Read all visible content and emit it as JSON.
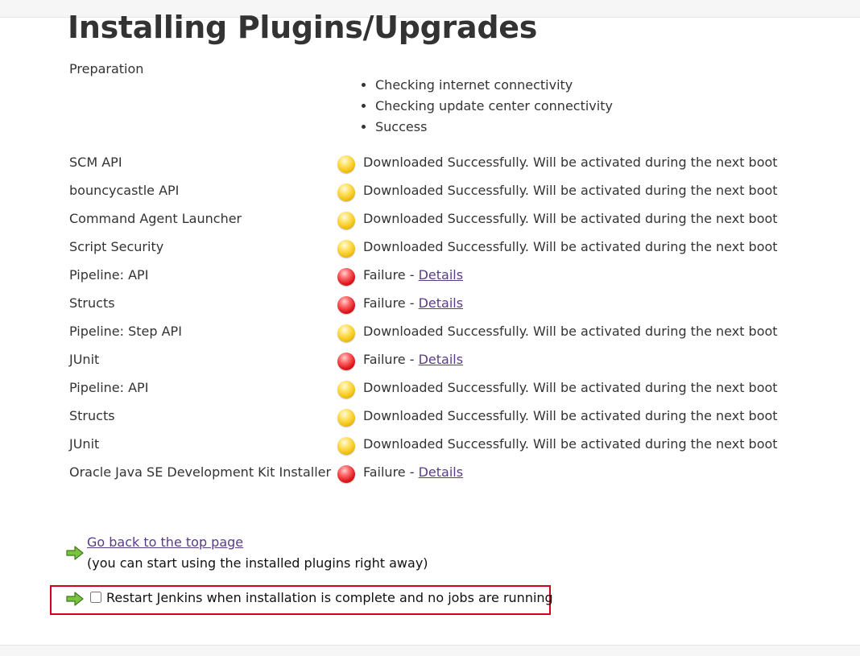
{
  "page": {
    "title": "Installing Plugins/Upgrades"
  },
  "preparation": {
    "label": "Preparation",
    "steps": [
      "Checking internet connectivity",
      "Checking update center connectivity",
      "Success"
    ]
  },
  "plugins": [
    {
      "name": "SCM API",
      "status": "success",
      "message": "Downloaded Successfully. Will be activated during the next boot"
    },
    {
      "name": "bouncycastle API",
      "status": "success",
      "message": "Downloaded Successfully. Will be activated during the next boot"
    },
    {
      "name": "Command Agent Launcher",
      "status": "success",
      "message": "Downloaded Successfully. Will be activated during the next boot"
    },
    {
      "name": "Script Security",
      "status": "success",
      "message": "Downloaded Successfully. Will be activated during the next boot"
    },
    {
      "name": "Pipeline: API",
      "status": "failure",
      "message": "Failure - ",
      "link": "Details"
    },
    {
      "name": "Structs",
      "status": "failure",
      "message": "Failure - ",
      "link": "Details"
    },
    {
      "name": "Pipeline: Step API",
      "status": "success",
      "message": "Downloaded Successfully. Will be activated during the next boot"
    },
    {
      "name": "JUnit",
      "status": "failure",
      "message": "Failure - ",
      "link": "Details"
    },
    {
      "name": "Pipeline: API",
      "status": "success",
      "message": "Downloaded Successfully. Will be activated during the next boot"
    },
    {
      "name": "Structs",
      "status": "success",
      "message": "Downloaded Successfully. Will be activated during the next boot"
    },
    {
      "name": "JUnit",
      "status": "success",
      "message": "Downloaded Successfully. Will be activated during the next boot"
    },
    {
      "name": "Oracle Java SE Development Kit Installer",
      "status": "failure",
      "message": "Failure - ",
      "link": "Details"
    }
  ],
  "status_colors": {
    "success": "#f4c312",
    "failure": "#e0181e"
  },
  "footer_actions": {
    "back_link": "Go back to the top page",
    "back_note": "(you can start using the installed plugins right away)",
    "restart_label": "Restart Jenkins when installation is complete and no jobs are running",
    "restart_checked": false,
    "arrow_icon": "green-arrow-right-icon",
    "highlight_color": "#d0021b",
    "link_color": "#5a3b88"
  }
}
